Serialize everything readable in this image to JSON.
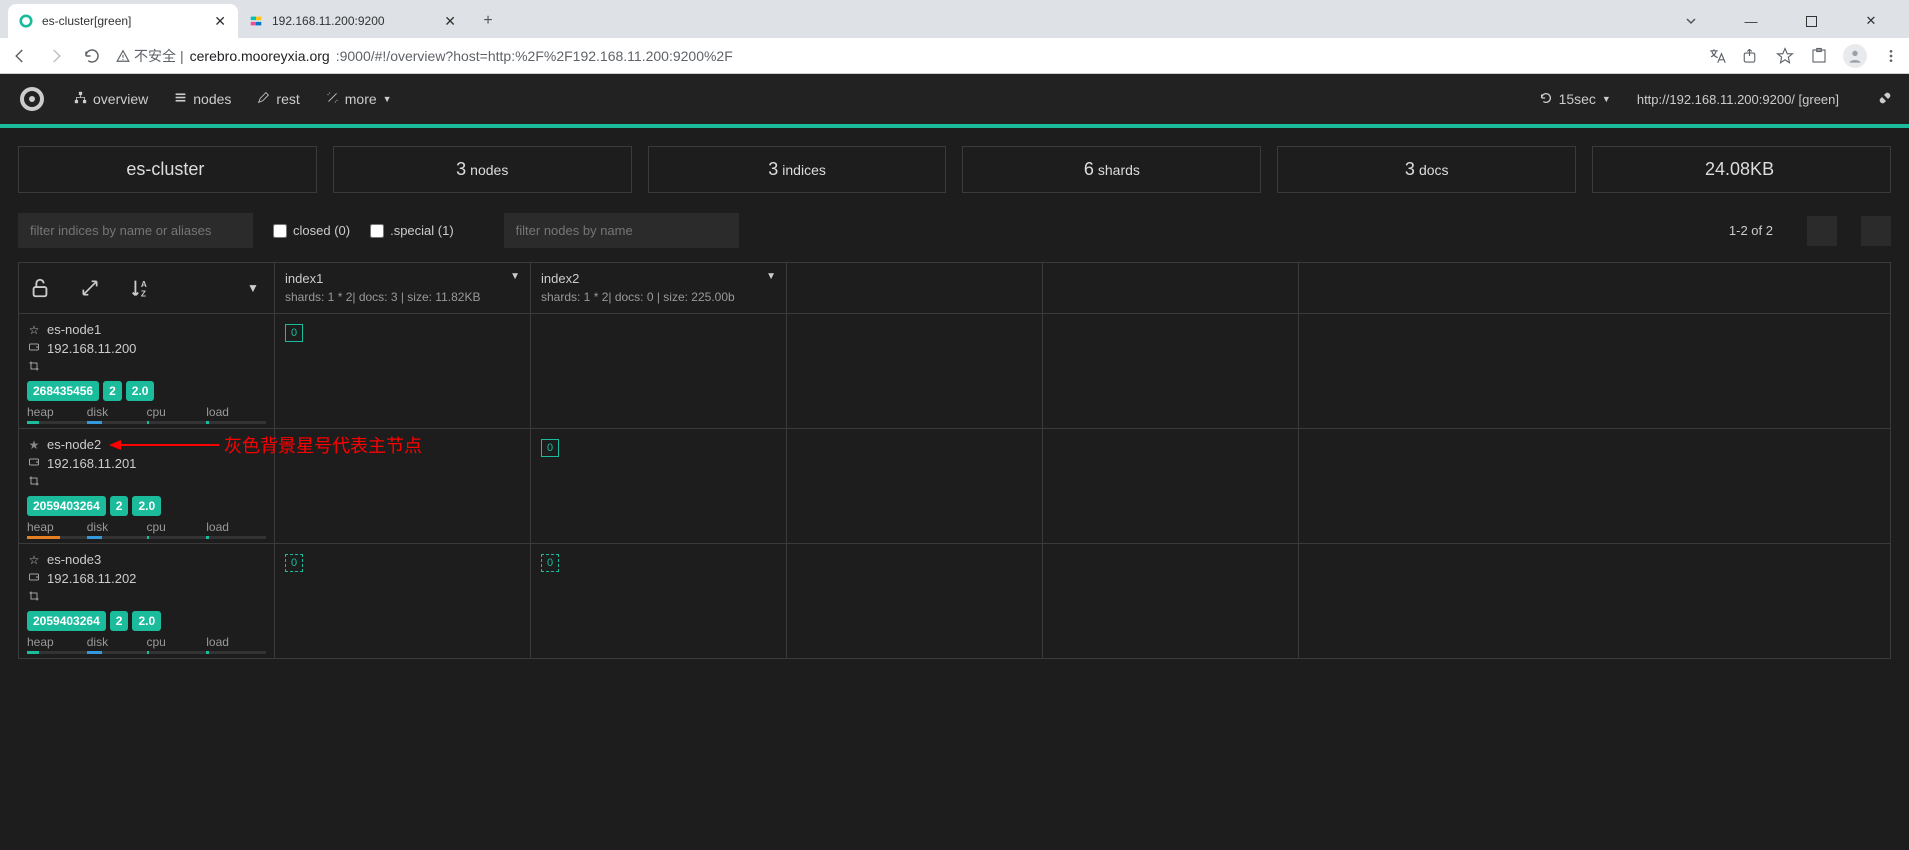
{
  "browser": {
    "tabs": [
      {
        "title": "es-cluster[green]",
        "active": true,
        "favicon": "green-dot"
      },
      {
        "title": "192.168.11.200:9200",
        "active": false,
        "favicon": "elastic"
      }
    ],
    "url_warn": "不安全",
    "url_host": "cerebro.mooreyxia.org",
    "url_path": ":9000/#!/overview?host=http:%2F%2F192.168.11.200:9200%2F"
  },
  "nav": {
    "overview": "overview",
    "nodes": "nodes",
    "rest": "rest",
    "more": "more",
    "refresh_interval": "15sec",
    "host_status": "http://192.168.11.200:9200/ [green]"
  },
  "stats": {
    "cluster_name": "es-cluster",
    "nodes_count": "3",
    "nodes_label": "nodes",
    "indices_count": "3",
    "indices_label": "indices",
    "shards_count": "6",
    "shards_label": "shards",
    "docs_count": "3",
    "docs_label": "docs",
    "size": "24.08KB"
  },
  "filters": {
    "indices_placeholder": "filter indices by name or aliases",
    "closed_label": "closed (0)",
    "special_label": ".special (1)",
    "nodes_placeholder": "filter nodes by name",
    "page_info": "1-2 of 2"
  },
  "indices": [
    {
      "name": "index1",
      "sub": "shards: 1 * 2| docs: 3 | size: 11.82KB"
    },
    {
      "name": "index2",
      "sub": "shards: 1 * 2| docs: 0 | size: 225.00b"
    }
  ],
  "nodes_list": [
    {
      "name": "es-node1",
      "ip": "192.168.11.200",
      "master": false,
      "badges": [
        "268435456",
        "2",
        "2.0"
      ],
      "metrics": [
        "heap",
        "disk",
        "cpu",
        "load"
      ],
      "shards": [
        {
          "i": 0,
          "v": "0",
          "solid": true
        },
        {
          "i": 1,
          "v": null
        }
      ]
    },
    {
      "name": "es-node2",
      "ip": "192.168.11.201",
      "master": true,
      "badges": [
        "2059403264",
        "2",
        "2.0"
      ],
      "metrics": [
        "heap",
        "disk",
        "cpu",
        "load"
      ],
      "shards": [
        {
          "i": 0,
          "v": null
        },
        {
          "i": 1,
          "v": "0",
          "solid": true
        }
      ]
    },
    {
      "name": "es-node3",
      "ip": "192.168.11.202",
      "master": false,
      "badges": [
        "2059403264",
        "2",
        "2.0"
      ],
      "metrics": [
        "heap",
        "disk",
        "cpu",
        "load"
      ],
      "shards": [
        {
          "i": 0,
          "v": "0",
          "solid": false
        },
        {
          "i": 1,
          "v": "0",
          "solid": false
        }
      ]
    }
  ],
  "annotation": {
    "text": "灰色背景星号代表主节点"
  }
}
